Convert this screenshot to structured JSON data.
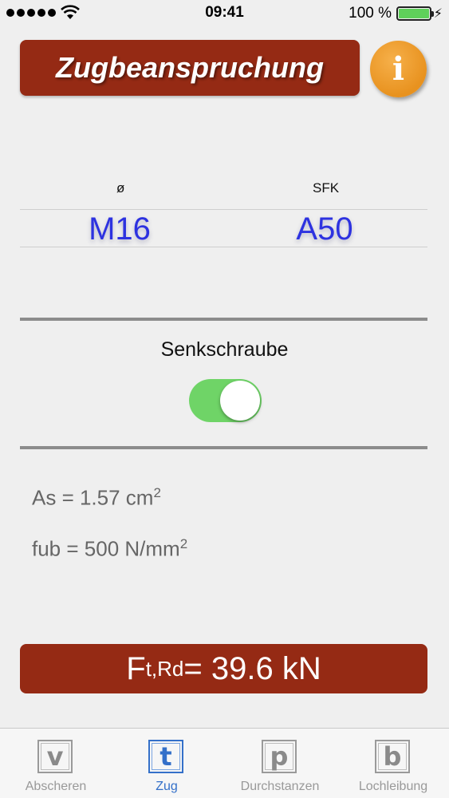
{
  "status_bar": {
    "time": "09:41",
    "battery": "100 %"
  },
  "header": {
    "title": "Zugbeanspruchung",
    "info_label": "i"
  },
  "picker": {
    "diameter_label": "ø",
    "class_label": "SFK",
    "diameter_value": "M16",
    "class_value": "A50"
  },
  "countersunk": {
    "label": "Senkschraube",
    "on": true
  },
  "results": {
    "as_text": "As = 1.57 cm",
    "as_exp": "2",
    "fub_text": "fub = 500 N/mm",
    "fub_exp": "2"
  },
  "force": {
    "main": "F",
    "sub": "t,Rd",
    "value": " = 39.6 kN"
  },
  "tabs": [
    {
      "icon": "v",
      "label": "Abscheren"
    },
    {
      "icon": "t",
      "label": "Zug"
    },
    {
      "icon": "p",
      "label": "Durchstanzen"
    },
    {
      "icon": "b",
      "label": "Lochleibung"
    }
  ],
  "colors": {
    "brand": "#952a14",
    "accent": "#3470c9",
    "toggle_on": "#6fd467",
    "picker_text": "#2d32e0"
  }
}
